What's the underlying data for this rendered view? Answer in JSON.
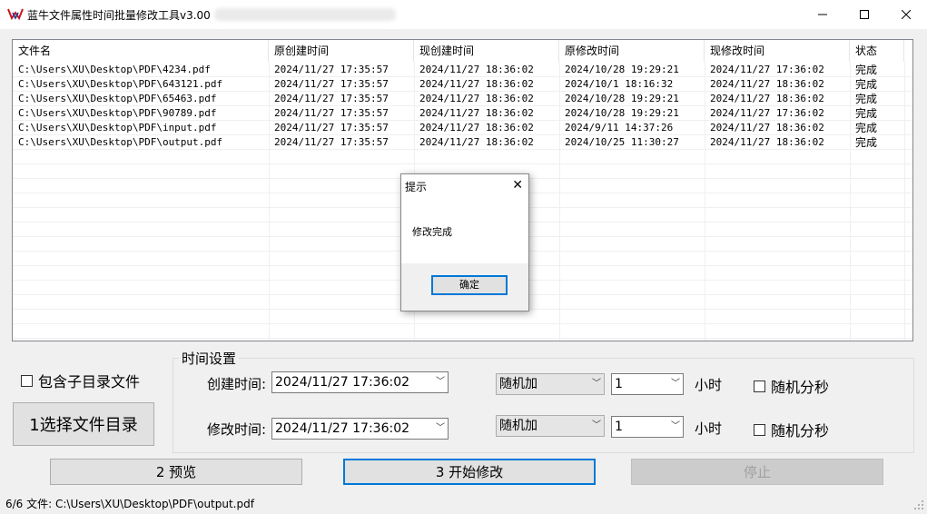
{
  "window": {
    "title": "蓝牛文件属性时间批量修改工具v3.00",
    "colors": {
      "accent": "#0078d7",
      "logo_red": "#c8141e",
      "logo_blue": "#1e3c9b"
    }
  },
  "table": {
    "columns": [
      "文件名",
      "原创建时间",
      "现创建时间",
      "原修改时间",
      "现修改时间",
      "状态"
    ],
    "rows": [
      [
        "C:\\Users\\XU\\Desktop\\PDF\\4234.pdf",
        "2024/11/27 17:35:57",
        "2024/11/27 18:36:02",
        "2024/10/28 19:29:21",
        "2024/11/27 17:36:02",
        "完成"
      ],
      [
        "C:\\Users\\XU\\Desktop\\PDF\\643121.pdf",
        "2024/11/27 17:35:57",
        "2024/11/27 18:36:02",
        "2024/10/1 18:16:32",
        "2024/11/27 18:36:02",
        "完成"
      ],
      [
        "C:\\Users\\XU\\Desktop\\PDF\\65463.pdf",
        "2024/11/27 17:35:57",
        "2024/11/27 18:36:02",
        "2024/10/28 19:29:21",
        "2024/11/27 18:36:02",
        "完成"
      ],
      [
        "C:\\Users\\XU\\Desktop\\PDF\\90789.pdf",
        "2024/11/27 17:35:57",
        "2024/11/27 18:36:02",
        "2024/10/28 19:29:21",
        "2024/11/27 17:36:02",
        "完成"
      ],
      [
        "C:\\Users\\XU\\Desktop\\PDF\\input.pdf",
        "2024/11/27 17:35:57",
        "2024/11/27 18:36:02",
        "2024/9/11 14:37:26",
        "2024/11/27 18:36:02",
        "完成"
      ],
      [
        "C:\\Users\\XU\\Desktop\\PDF\\output.pdf",
        "2024/11/27 17:35:57",
        "2024/11/27 18:36:02",
        "2024/10/25 11:30:27",
        "2024/11/27 18:36:02",
        "完成"
      ]
    ]
  },
  "dialog": {
    "title": "提示",
    "message": "修改完成",
    "ok_label": "确定"
  },
  "options": {
    "include_subdirs_label": "包含子目录文件",
    "select_dir_label": "1选择文件目录"
  },
  "time_settings": {
    "group_label": "时间设置",
    "create_label": "创建时间:",
    "create_value": "2024/11/27  17:36:02",
    "modify_label": "修改时间:",
    "modify_value": "2024/11/27  17:36:02",
    "create_mode": "随机加",
    "modify_mode": "随机加",
    "create_amount": "1",
    "modify_amount": "1",
    "hours_label": "小时",
    "random_minsec_label": "随机分秒"
  },
  "actions": {
    "preview_label": "2 预览",
    "start_label": "3 开始修改",
    "stop_label": "停止"
  },
  "status": {
    "text": "6/6 文件:  C:\\Users\\XU\\Desktop\\PDF\\output.pdf"
  }
}
